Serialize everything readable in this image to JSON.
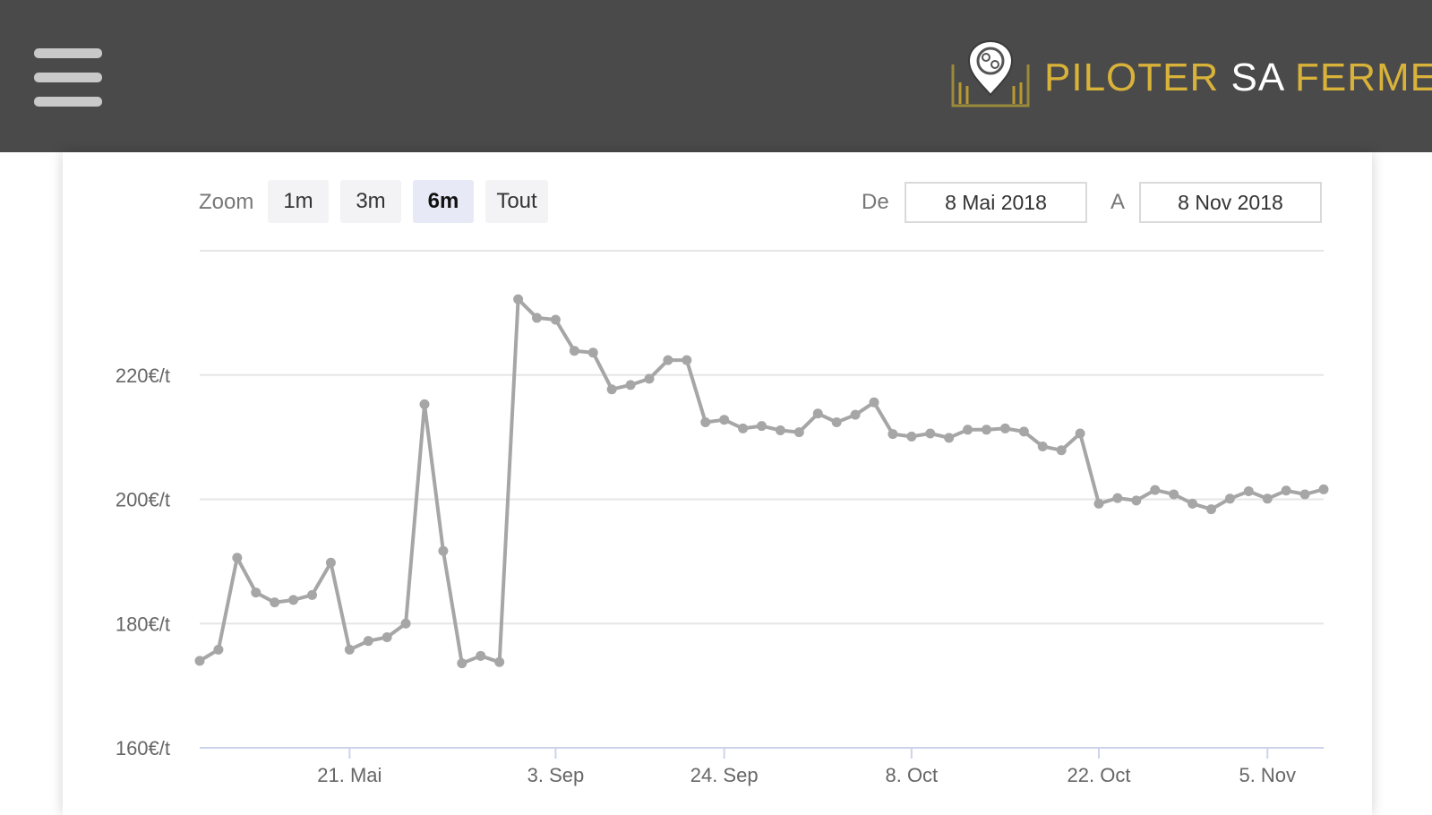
{
  "header": {
    "menu_icon": "hamburger-icon",
    "logo_icon": "map-pin-logo-icon",
    "brand_word1": "PILOTER",
    "brand_word2": "SA",
    "brand_word3": "FERME",
    "colors": {
      "background": "#4a4a4a",
      "gold": "#d9b23a",
      "white": "#ffffff"
    }
  },
  "toolbar": {
    "zoom_label": "Zoom",
    "zoom_buttons": [
      "1m",
      "3m",
      "6m",
      "Tout"
    ],
    "active_zoom": "6m",
    "from_label": "De",
    "from_value": "8 Mai 2018",
    "to_label": "A",
    "to_value": "8 Nov 2018"
  },
  "chart_data": {
    "type": "line",
    "title": "",
    "xlabel": "",
    "ylabel": "",
    "ylim": [
      160,
      240
    ],
    "y_ticks": [
      {
        "value": 160,
        "label": "160€/t"
      },
      {
        "value": 180,
        "label": "180€/t"
      },
      {
        "value": 200,
        "label": "200€/t"
      },
      {
        "value": 220,
        "label": "220€/t"
      }
    ],
    "x_ticks": [
      "21. Mai",
      "3. Sep",
      "24. Sep",
      "8. Oct",
      "22. Oct",
      "5. Nov"
    ],
    "x_tick_index": [
      8,
      19,
      28,
      38,
      48,
      57
    ],
    "grid": true,
    "line_color": "#a6a6a6",
    "series": [
      {
        "values": [
          174,
          175.8,
          190.6,
          185,
          183.4,
          183.8,
          184.6,
          189.8,
          175.8,
          177.2,
          177.8,
          180,
          215.3,
          191.7,
          173.6,
          174.8,
          173.8,
          232.2,
          229.2,
          228.9,
          223.9,
          223.6,
          217.7,
          218.4,
          219.4,
          222.4,
          222.4,
          212.4,
          212.8,
          211.4,
          211.8,
          211.1,
          210.8,
          213.8,
          212.4,
          213.6,
          215.6,
          210.5,
          210.1,
          210.6,
          209.9,
          211.2,
          211.2,
          211.4,
          210.9,
          208.5,
          207.9,
          210.6,
          199.3,
          200.2,
          199.8,
          201.5,
          200.8,
          199.3,
          198.4,
          200.1,
          201.3,
          200.1,
          201.4,
          200.8,
          201.6
        ]
      }
    ]
  }
}
